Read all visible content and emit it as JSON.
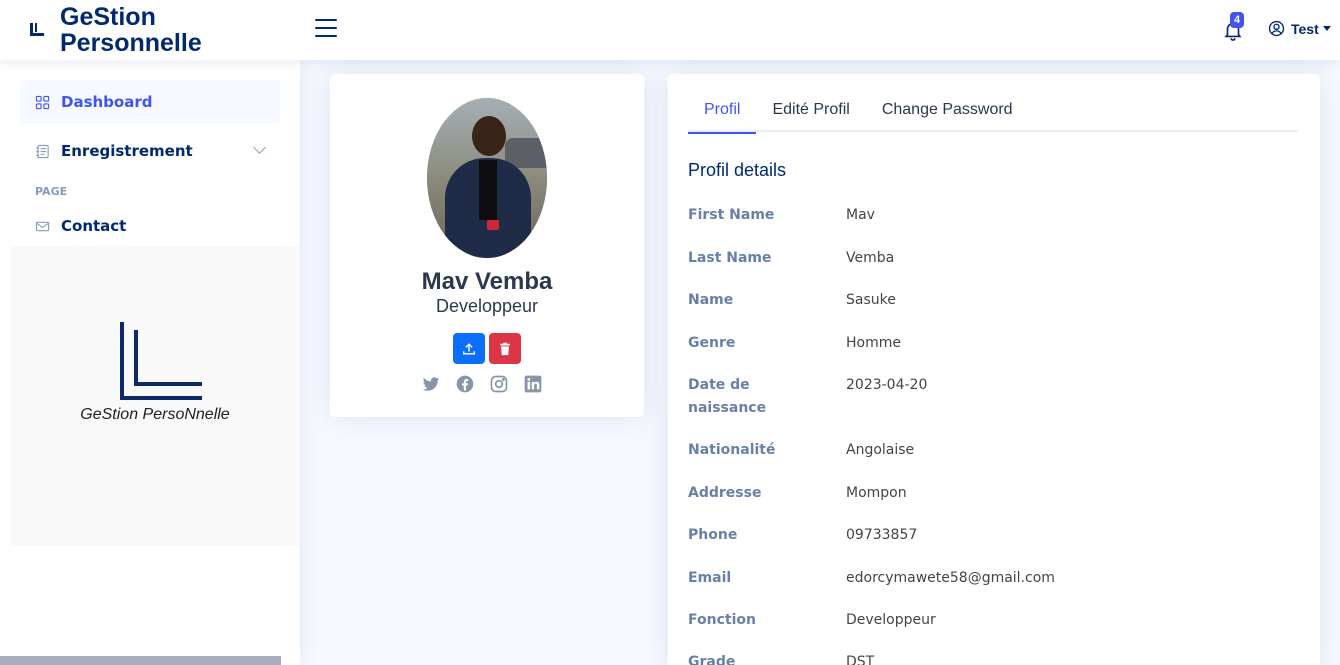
{
  "header": {
    "brand_line1": "GeStion",
    "brand_line2": "Personnelle",
    "notification_count": "4",
    "user_name": "Test"
  },
  "sidebar": {
    "items": [
      {
        "label": "Dashboard",
        "active": true,
        "icon": "grid-icon"
      },
      {
        "label": "Enregistrement",
        "active": false,
        "icon": "journal-text-icon"
      }
    ],
    "heading": "PAGE",
    "page_items": [
      {
        "label": "Contact",
        "icon": "envelope-icon"
      }
    ],
    "brand_caption": "GeStion PersoNnelle"
  },
  "profile": {
    "name": "Mav Vemba",
    "role": "Developpeur",
    "socials": [
      "twitter-icon",
      "facebook-icon",
      "instagram-icon",
      "linkedin-icon"
    ]
  },
  "tabs": [
    {
      "label": "Profil",
      "active": true
    },
    {
      "label": "Edité Profil",
      "active": false
    },
    {
      "label": "Change Password",
      "active": false
    }
  ],
  "details": {
    "title": "Profil details",
    "rows": [
      {
        "label": "First Name",
        "value": "Mav"
      },
      {
        "label": "Last Name",
        "value": "Vemba"
      },
      {
        "label": "Name",
        "value": "Sasuke"
      },
      {
        "label": "Genre",
        "value": "Homme"
      },
      {
        "label_line1": "Date de",
        "label_line2": "naissance",
        "value": "2023-04-20"
      },
      {
        "label": "Nationalité",
        "value": "Angolaise"
      },
      {
        "label": "Addresse",
        "value": "Mompon"
      },
      {
        "label": "Phone",
        "value": "09733857"
      },
      {
        "label": "Email",
        "value": "edorcymawete58@gmail.com"
      },
      {
        "label": "Fonction",
        "value": "Developpeur"
      },
      {
        "label": "Grade",
        "value": "DST"
      }
    ]
  },
  "colors": {
    "primary": "#4154f1",
    "navy": "#012970",
    "danger": "#dc3545",
    "upload": "#0d6efd"
  }
}
